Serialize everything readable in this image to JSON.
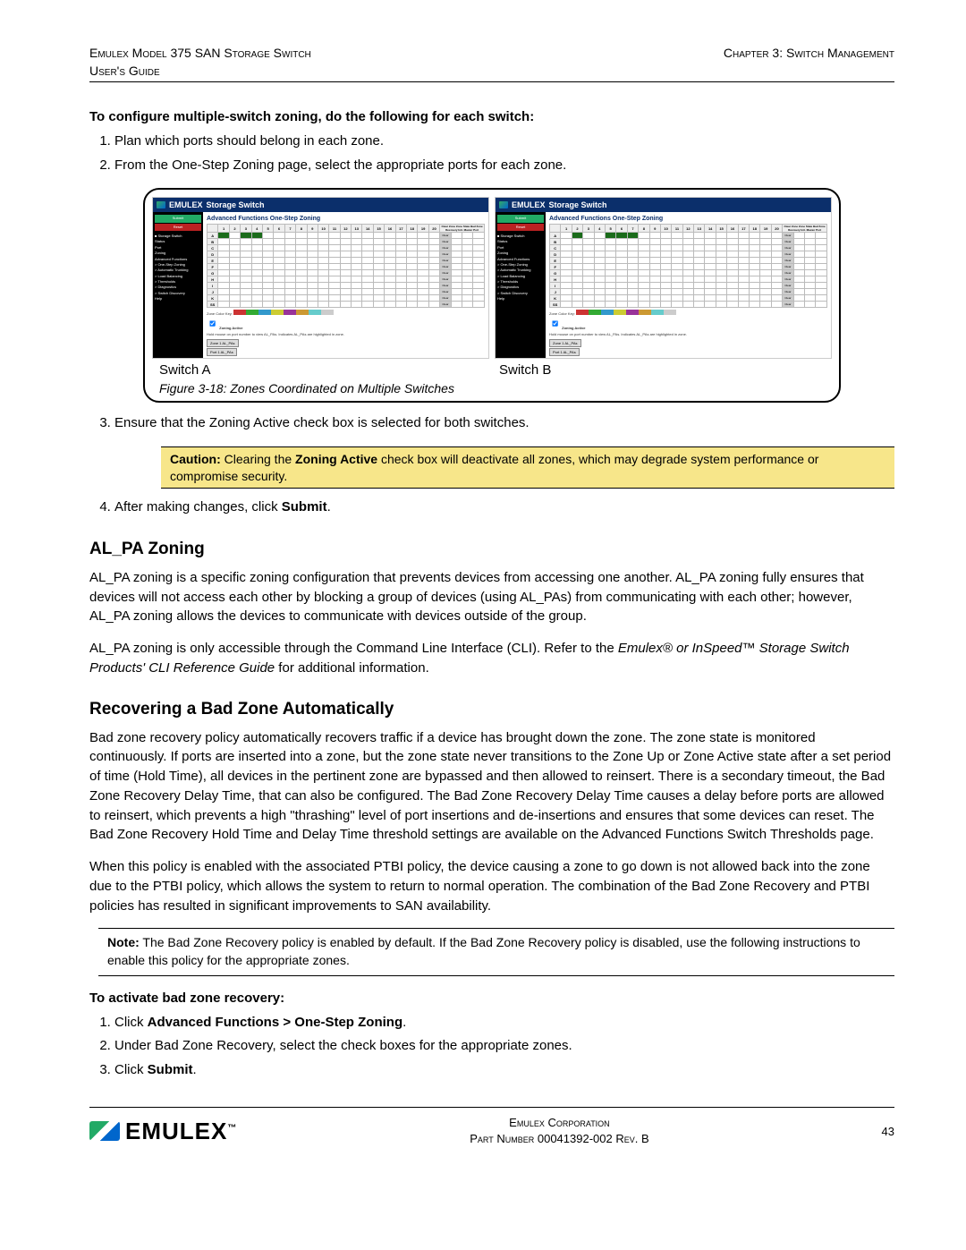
{
  "header": {
    "left_line1": "Emulex Model 375 SAN Storage Switch",
    "left_line2": "User's Guide",
    "right_line1": "",
    "right_line2": "Chapter 3: Switch Management"
  },
  "intro_lead": "To configure multiple-switch zoning, do the following for each switch:",
  "steps_a": [
    "Plan which ports should belong in each zone.",
    "From the One-Step Zoning page, select the appropriate ports for each zone."
  ],
  "screenshot": {
    "app_title_brand": "EMULEX",
    "app_title": "Storage Switch",
    "panel_heading": "Advanced Functions One-Step Zoning",
    "sidebar_items": [
      "Status",
      "Port",
      "Zoning",
      "Advanced Functions",
      "> One-Step Zoning",
      "> Automatic Trunking",
      "> Load Balancing",
      "> Thresholds",
      "> Diagnostics",
      "> Switch Discovery",
      "Help"
    ],
    "grid": {
      "zones": [
        "A",
        "B",
        "C",
        "D",
        "E",
        "F",
        "G",
        "H",
        "I",
        "J",
        "K",
        "SS"
      ],
      "ports": [
        "1",
        "2",
        "3",
        "4",
        "5",
        "6",
        "7",
        "8",
        "9",
        "10",
        "11",
        "12",
        "13",
        "14",
        "15",
        "16",
        "17",
        "18",
        "19",
        "20"
      ],
      "extra_cols": [
        "Clear Zone",
        "Zone State",
        "Bad Zone Recovery",
        "Init. Master Port"
      ],
      "clear_btn": "Clear"
    },
    "a_highlight_row": "A",
    "a_highlight_ports": [
      "1",
      "3",
      "4"
    ],
    "b_highlight_row": "A",
    "b_highlight_ports": [
      "2",
      "5",
      "6",
      "7"
    ],
    "clear_strip_label": "Zone Color Key:",
    "clear_strip_colors": [
      "#c33",
      "#3a3",
      "#39c",
      "#cc3",
      "#939",
      "#c93",
      "#6cc",
      "#ccc"
    ],
    "zoning_active_label": "Zoning Active",
    "hint_text": "Hold mouse on port number to view AL_PAs. Indicates AL_PAs are highlighted in zone.",
    "buttons": [
      "Zone 1 AL_PAs",
      "Port 1 AL_PAs"
    ]
  },
  "switch_labels": {
    "a": "Switch A",
    "b": "Switch B"
  },
  "figure_caption": "Figure 3-18: Zones Coordinated on Multiple Switches",
  "steps_b_start": 3,
  "steps_b": [
    "Ensure that the Zoning Active check box is selected for both switches."
  ],
  "caution": {
    "label": "Caution:",
    "bold_inline": "Zoning Active",
    "text_before": " Clearing the ",
    "text_after": " check box will deactivate all zones, which may degrade system performance or compromise security."
  },
  "steps_c_start": 4,
  "steps_c_prefix": "After making changes, click ",
  "steps_c_bold": "Submit",
  "steps_c_suffix": ".",
  "h2_alpa": "AL_PA Zoning",
  "alpa_p1": "AL_PA zoning is a specific zoning configuration that prevents devices from accessing one another. AL_PA zoning fully ensures that devices will not access each other by blocking a group of devices (using AL_PAs) from communicating with each other; however, AL_PA zoning allows the devices to communicate with devices outside of the group.",
  "alpa_p2_before": "AL_PA zoning is only accessible through the Command Line Interface (CLI). Refer to the ",
  "alpa_p2_italic": "Emulex® or InSpeed™ Storage Switch Products' CLI Reference Guide",
  "alpa_p2_after": " for additional information.",
  "h2_recover": "Recovering a Bad Zone Automatically",
  "recover_p1": "Bad zone recovery policy automatically recovers traffic if a device has brought down the zone. The zone state is monitored continuously. If ports are inserted into a zone, but the zone state never transitions to the Zone Up or Zone Active state after a set period of time (Hold Time), all devices in the pertinent zone are bypassed and then allowed to reinsert. There is a secondary timeout, the Bad Zone Recovery Delay Time, that can also be configured. The Bad Zone Recovery Delay Time causes a delay before ports are allowed to reinsert, which prevents a high \"thrashing\" level of port insertions and de-insertions and ensures that some devices can reset. The Bad Zone Recovery Hold Time and Delay Time threshold settings are available on the Advanced Functions Switch Thresholds page.",
  "recover_p2": "When this policy is enabled with the associated PTBI policy, the device causing a zone to go down is not allowed back into the zone due to the PTBI policy, which allows the system to return to normal operation. The combination of the Bad Zone Recovery and PTBI policies has resulted in significant improvements to SAN availability.",
  "note": {
    "label": "Note:",
    "text": " The Bad Zone Recovery policy is enabled by default. If the Bad Zone Recovery policy is disabled, use the following instructions to enable this policy for the appropriate zones."
  },
  "activate_lead": "To activate bad zone recovery:",
  "activate_steps": [
    {
      "pre": "Click ",
      "bold": "Advanced Functions > One-Step Zoning",
      "post": "."
    },
    {
      "pre": "Under Bad Zone Recovery, select the check boxes for the appropriate zones.",
      "bold": "",
      "post": ""
    },
    {
      "pre": "Click ",
      "bold": "Submit",
      "post": "."
    }
  ],
  "footer": {
    "brand": "EMULEX",
    "tm": "™",
    "center1": "Emulex Corporation",
    "center2": "Part Number 00041392-002 Rev. B",
    "page_no": "43"
  }
}
